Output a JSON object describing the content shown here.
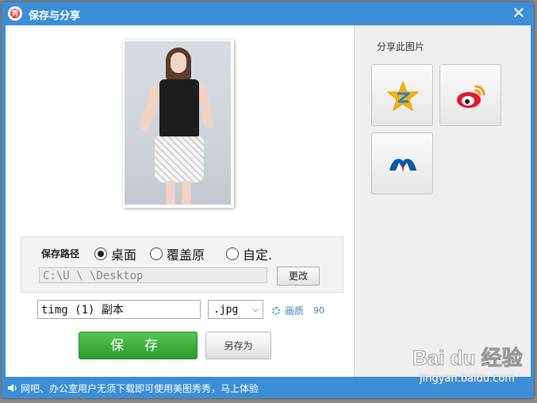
{
  "window": {
    "title": "保存与分享",
    "app_icon_text": "秀",
    "close_glyph": "✕"
  },
  "save_path": {
    "label": "保存路径",
    "options": [
      {
        "label": "桌面",
        "selected": true
      },
      {
        "label": "覆盖原",
        "selected": false
      },
      {
        "label": "自定.",
        "selected": false
      }
    ],
    "path_value": "C:\\U          \\      \\Desktop",
    "change_label": "更改"
  },
  "file": {
    "name_value": "timg (1) 副本",
    "extension": ".jpg",
    "quality_label": "画质",
    "quality_value": "90"
  },
  "buttons": {
    "save_label": "保 存",
    "save_as_label": "另存为"
  },
  "share": {
    "title": "分享此图片",
    "targets": [
      {
        "icon": "qzone-icon"
      },
      {
        "icon": "weibo-icon"
      },
      {
        "icon": "renren-icon"
      }
    ]
  },
  "status": {
    "text": "网吧、办公室用户无须下载即可使用美图秀秀，马上体验"
  },
  "watermark": {
    "logo_text": "Bai du 经验",
    "url": "jingyan.baidu.com"
  },
  "colors": {
    "titlebar": "#3c8fd6",
    "save_green": "#2c9a2c",
    "link_blue": "#3a84c4"
  }
}
